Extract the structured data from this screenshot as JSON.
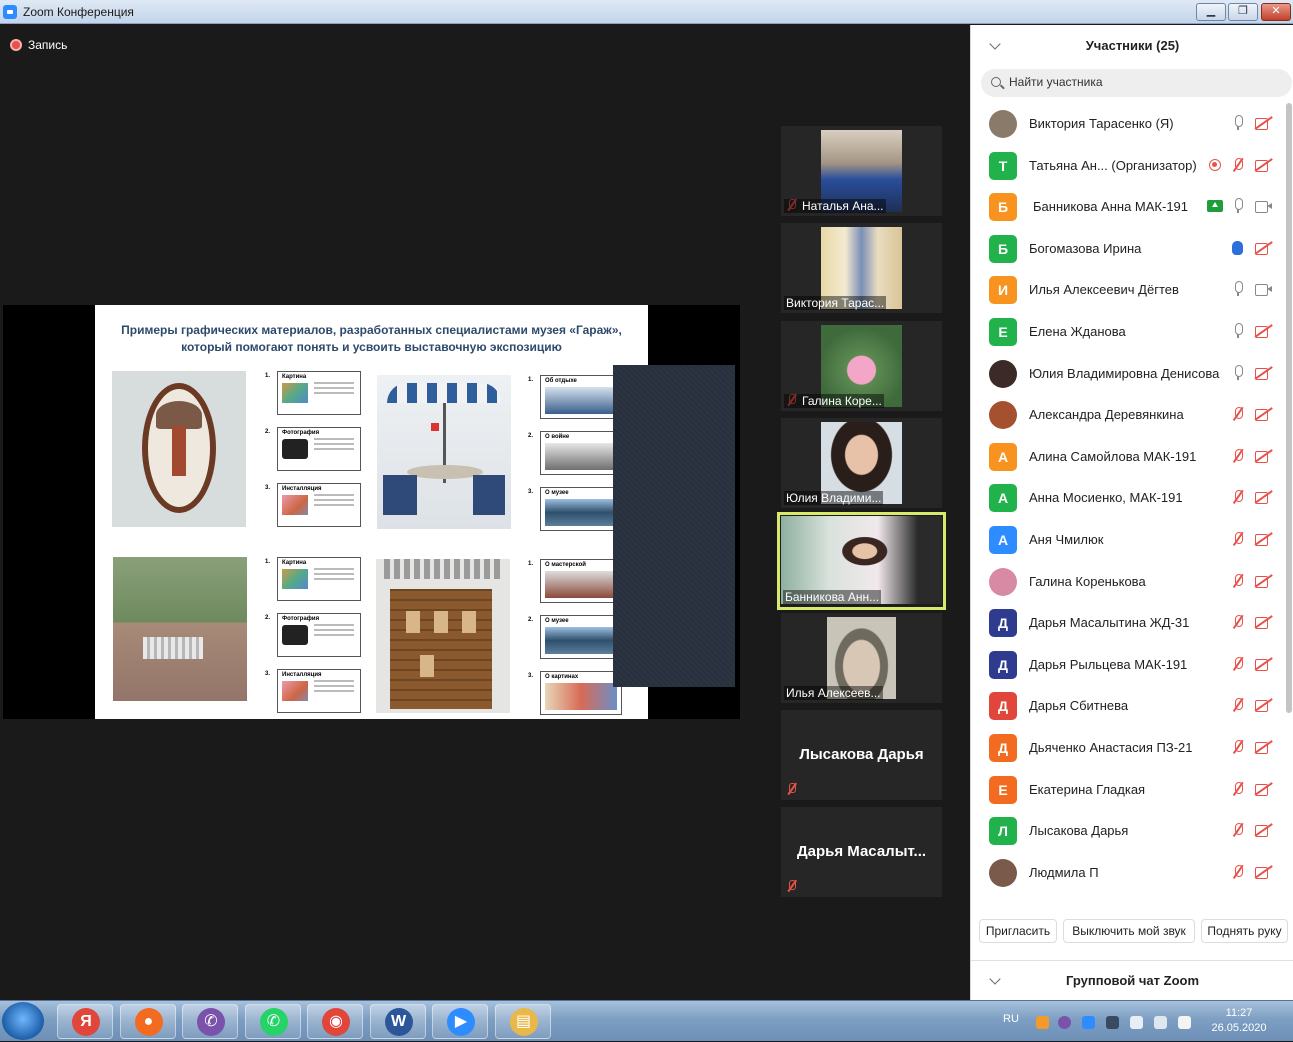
{
  "window": {
    "title": "Zoom Конференция",
    "min_label": "▁",
    "max_label": "❐",
    "close_label": "✕"
  },
  "recording": {
    "label": "Запись"
  },
  "slide": {
    "title": "Примеры графических материалов, разработанных специалистами музея «Гараж», который помогают понять и усвоить выставочную экспозицию",
    "numbers": [
      "1.",
      "2.",
      "3."
    ],
    "cards_left_top": [
      "Картина",
      "Фотография",
      "Инсталляция"
    ],
    "cards_right_top": [
      "Об отдыхе",
      "О войне",
      "О музее"
    ],
    "cards_left_bottom": [
      "Картина",
      "Фотография",
      "Инсталляция"
    ],
    "cards_right_bottom": [
      "О мастерской",
      "О музее",
      "О картинах"
    ]
  },
  "gallery": [
    {
      "name": "Наталья Ана...",
      "muted": true,
      "video": true
    },
    {
      "name": "Виктория Тарас...",
      "muted": false,
      "video": true
    },
    {
      "name": "Галина Коре...",
      "muted": true,
      "video": true
    },
    {
      "name": "Юлия Владими...",
      "muted": false,
      "video": true
    },
    {
      "name": "Банникова Анн...",
      "muted": false,
      "video": true,
      "active": true
    },
    {
      "name": "Илья Алексеев...",
      "muted": false,
      "video": true
    },
    {
      "name": "Лысакова Дарья",
      "muted": true,
      "video": false
    },
    {
      "name": "Дарья Масалыт...",
      "muted": true,
      "video": false
    }
  ],
  "panel": {
    "title": "Участники (25)",
    "search_placeholder": "Найти участника",
    "participants": [
      {
        "name": "Виктория Тарасенко (Я)",
        "avatar": "",
        "photo": true,
        "color": "#8a7a6a",
        "mic": "on",
        "cam": "off"
      },
      {
        "name": "Татьяна Ан...  (Организатор)",
        "avatar": "Т",
        "color": "#22b24c",
        "mic": "off",
        "cam": "off",
        "rec": true
      },
      {
        "name": "Банникова Анна МАК-191",
        "avatar": "Б",
        "color": "#f7931e",
        "mic": "on",
        "cam": "on",
        "share": true
      },
      {
        "name": "Богомазова Ирина",
        "avatar": "Б",
        "color": "#22b24c",
        "mic": "hand",
        "cam": "off"
      },
      {
        "name": "Илья Алексеевич Дёгтев",
        "avatar": "И",
        "color": "#f7931e",
        "mic": "on",
        "cam": "on"
      },
      {
        "name": "Елена Жданова",
        "avatar": "Е",
        "color": "#22b24c",
        "mic": "on",
        "cam": "off"
      },
      {
        "name": "Юлия Владимировна Денисова",
        "avatar": "",
        "photo": true,
        "color": "#3b2a28",
        "mic": "on",
        "cam": "off"
      },
      {
        "name": "Александра Деревянкина",
        "avatar": "",
        "photo": true,
        "color": "#a5502e",
        "mic": "off",
        "cam": "off"
      },
      {
        "name": "Алина Самойлова МАК-191",
        "avatar": "А",
        "color": "#f7931e",
        "mic": "off",
        "cam": "off"
      },
      {
        "name": "Анна Мосиенко, МАК-191",
        "avatar": "А",
        "color": "#22b24c",
        "mic": "off",
        "cam": "off"
      },
      {
        "name": "Аня Чмилюк",
        "avatar": "А",
        "color": "#2d8cff",
        "mic": "off",
        "cam": "off"
      },
      {
        "name": "Галина Коренькова",
        "avatar": "",
        "photo": true,
        "color": "#d88aa5",
        "mic": "off",
        "cam": "off"
      },
      {
        "name": "Дарья Масалытина ЖД-31",
        "avatar": "Д",
        "color": "#2e3b8f",
        "mic": "off",
        "cam": "off"
      },
      {
        "name": "Дарья Рыльцева МАК-191",
        "avatar": "Д",
        "color": "#2e3b8f",
        "mic": "off",
        "cam": "off"
      },
      {
        "name": "Дарья Сбитнева",
        "avatar": "Д",
        "color": "#e0463a",
        "mic": "off",
        "cam": "off"
      },
      {
        "name": "Дьяченко Анастасия ПЗ-21",
        "avatar": "Д",
        "color": "#f26b21",
        "mic": "off",
        "cam": "off"
      },
      {
        "name": "Екатерина Гладкая",
        "avatar": "Е",
        "color": "#f26b21",
        "mic": "off",
        "cam": "off"
      },
      {
        "name": "Лысакова Дарья",
        "avatar": "Л",
        "color": "#22b24c",
        "mic": "off",
        "cam": "off"
      },
      {
        "name": "Людмила П",
        "avatar": "",
        "photo": true,
        "color": "#7a5a4a",
        "mic": "off",
        "cam": "off"
      }
    ],
    "buttons": {
      "invite": "Пригласить",
      "mute_me": "Выключить мой звук",
      "raise_hand": "Поднять руку"
    },
    "chat_title": "Групповой чат Zoom"
  },
  "taskbar": {
    "apps": [
      {
        "name": "yandex-browser",
        "glyph": "Я",
        "color": "#e0463a"
      },
      {
        "name": "firefox",
        "glyph": "●",
        "color": "#f26b21"
      },
      {
        "name": "viber",
        "glyph": "✆",
        "color": "#7b52ab"
      },
      {
        "name": "whatsapp",
        "glyph": "✆",
        "color": "#25d366"
      },
      {
        "name": "camera-app",
        "glyph": "◉",
        "color": "#e0463a"
      },
      {
        "name": "word",
        "glyph": "W",
        "color": "#2b579a"
      },
      {
        "name": "zoom",
        "glyph": "▶",
        "color": "#2d8cff"
      },
      {
        "name": "explorer",
        "glyph": "▤",
        "color": "#e8b84a"
      }
    ],
    "lang": "RU",
    "time": "11:27",
    "date": "26.05.2020"
  }
}
